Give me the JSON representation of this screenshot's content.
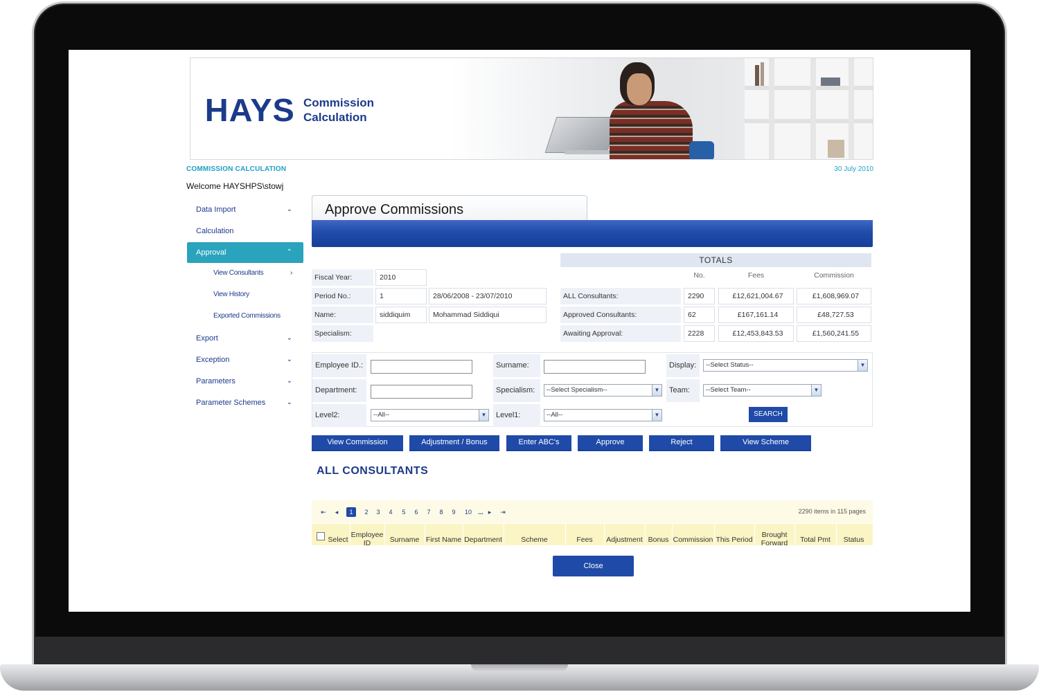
{
  "banner": {
    "logo": "HAYS",
    "subtitle_line1": "Commission",
    "subtitle_line2": "Calculation"
  },
  "header": {
    "breadcrumb": "COMMISSION CALCULATION",
    "date": "30 July 2010",
    "welcome": "Welcome  HAYSHPS\\stowj"
  },
  "sidebar": {
    "items": [
      {
        "label": "Data Import",
        "chevron": "⌄"
      },
      {
        "label": "Calculation",
        "chevron": ""
      },
      {
        "label": "Approval",
        "chevron": "^"
      },
      {
        "label": "Export",
        "chevron": "⌄"
      },
      {
        "label": "Exception",
        "chevron": "⌄"
      },
      {
        "label": "Parameters",
        "chevron": "⌄"
      },
      {
        "label": "Parameter Schemes",
        "chevron": "⌄"
      }
    ],
    "subitems": [
      {
        "label": "View Consultants",
        "chevron": ">"
      },
      {
        "label": "View History"
      },
      {
        "label": "Exported Commissions"
      }
    ]
  },
  "page": {
    "title": "Approve Commissions",
    "section_title": "ALL CONSULTANTS"
  },
  "info": {
    "fiscal_year_label": "Fiscal Year:",
    "fiscal_year": "2010",
    "period_label": "Period No.:",
    "period": "1",
    "period_range": "28/06/2008 - 23/07/2010",
    "name_label": "Name:",
    "name_user": "siddiquim",
    "name_full": "Mohammad Siddiqui",
    "specialism_label": "Specialism:"
  },
  "totals": {
    "title": "TOTALS",
    "headers": [
      "No.",
      "Fees",
      "Commission"
    ],
    "rows": [
      {
        "label": "ALL Consultants:",
        "no": "2290",
        "fees": "£12,621,004.67",
        "commission": "£1,608,969.07"
      },
      {
        "label": "Approved Consultants:",
        "no": "62",
        "fees": "£167,161.14",
        "commission": "£48,727.53"
      },
      {
        "label": "Awaiting Approval:",
        "no": "2228",
        "fees": "£12,453,843.53",
        "commission": "£1,560,241.55"
      }
    ]
  },
  "filters": {
    "employee_id_label": "Employee ID.:",
    "surname_label": "Surname:",
    "display_label": "Display:",
    "display_value": "--Select Status--",
    "department_label": "Department:",
    "specialism_label": "Specialism:",
    "specialism_value": "--Select Specialism--",
    "team_label": "Team:",
    "team_value": "--Select Team--",
    "level2_label": "Level2:",
    "level2_value": "--All--",
    "level1_label": "Level1:",
    "level1_value": "--All--",
    "search_label": "SEARCH"
  },
  "actions": [
    "View Commission",
    "Adjustment / Bonus",
    "Enter ABC's",
    "Approve",
    "Reject",
    "View Scheme"
  ],
  "grid": {
    "pager": {
      "first": "⇤",
      "prev": "◂",
      "pages": [
        "1",
        "2",
        "3",
        "4",
        "5",
        "6",
        "7",
        "8",
        "9",
        "10"
      ],
      "ellipsis": "...",
      "next": "▸",
      "last": "⇥",
      "current": "1",
      "info": "2290 items in 115 pages"
    },
    "columns": [
      "Select",
      "Employee ID",
      "Surname",
      "First Name",
      "Department",
      "Scheme",
      "Fees",
      "Adjustment",
      "Bonus",
      "Commission",
      "This Period",
      "Brought Forward",
      "Total Pmt",
      "Status"
    ]
  },
  "footer": {
    "close_label": "Close"
  },
  "colors": {
    "brand_blue": "#1f4aa8",
    "accent_teal": "#2aa3bd",
    "crumb_cyan": "#1e9fc4"
  }
}
